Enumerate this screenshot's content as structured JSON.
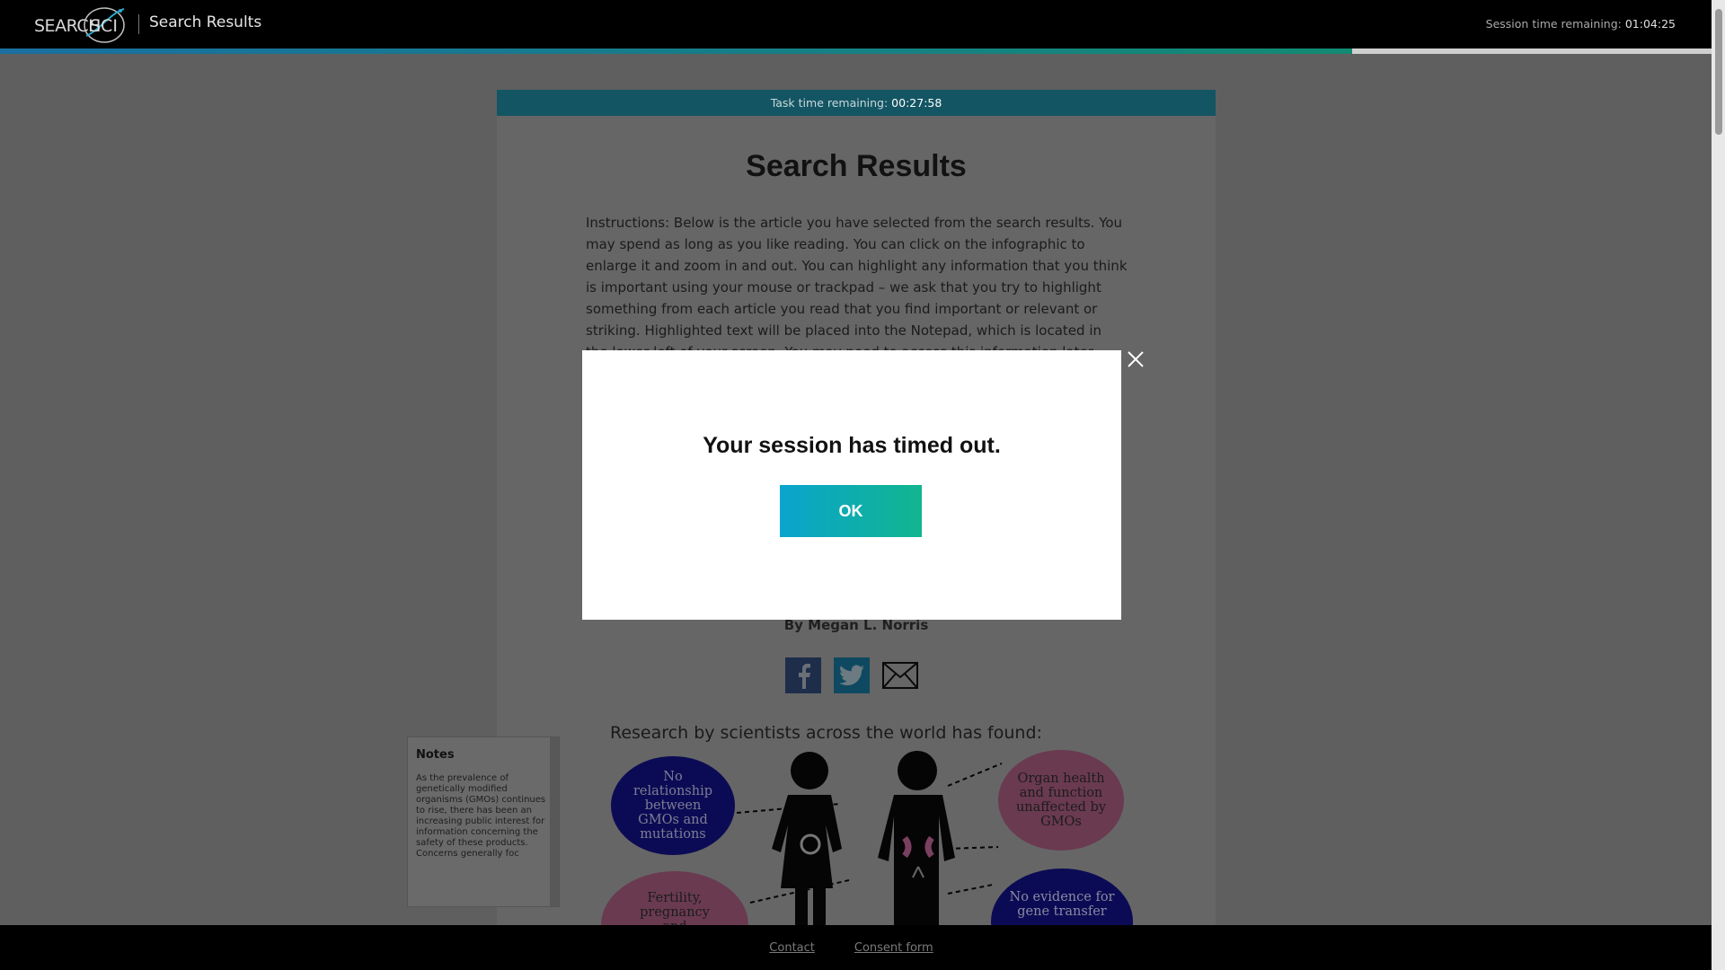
{
  "header": {
    "logo_left": "SEARCH",
    "logo_right": "SCI",
    "title": "Search Results",
    "session_label": "Session time remaining:",
    "session_value": "01:04:25",
    "progress_fraction": 0.79
  },
  "task": {
    "label": "Task time remaining:",
    "value": "00:27:58"
  },
  "main": {
    "title": "Search Results",
    "instructions": "Instructions: Below is the article you have selected from the search results. You may spend as long as you like reading. You can click on the infographic to enlarge it and zoom in and out. You can highlight any information that you think is important using your mouse or trackpad – we ask that you try to highlight something from each article you read that you find important or relevant or striking. Highlighted text will be placed into the Notepad, which is located in the lower left of your screen. You may need to access this information later.",
    "byline": "By Megan L. Norris"
  },
  "share": {
    "icons": [
      "facebook-icon",
      "twitter-icon",
      "email-icon"
    ]
  },
  "infographic": {
    "title": "Research by scientists across the world has found:",
    "bubbles": [
      "No relationship between GMOs and mutations",
      "Organ health and function unaffected by GMOs",
      "Fertility, pregnancy and",
      "No evidence for gene transfer"
    ]
  },
  "notes": {
    "title": "Notes",
    "body": "As the prevalence of genetically modified organisms (GMOs) continues to rise, there has been an increasing public interest for information concerning the safety of these products. Concerns generally foc"
  },
  "modal": {
    "message": "Your session has timed out.",
    "ok_label": "OK"
  },
  "footer": {
    "contact": "Contact",
    "consent": "Consent form"
  },
  "colors": {
    "task_bar": "#135563",
    "ok_gradient_start": "#0aa4cd",
    "ok_gradient_end": "#12b58f"
  }
}
